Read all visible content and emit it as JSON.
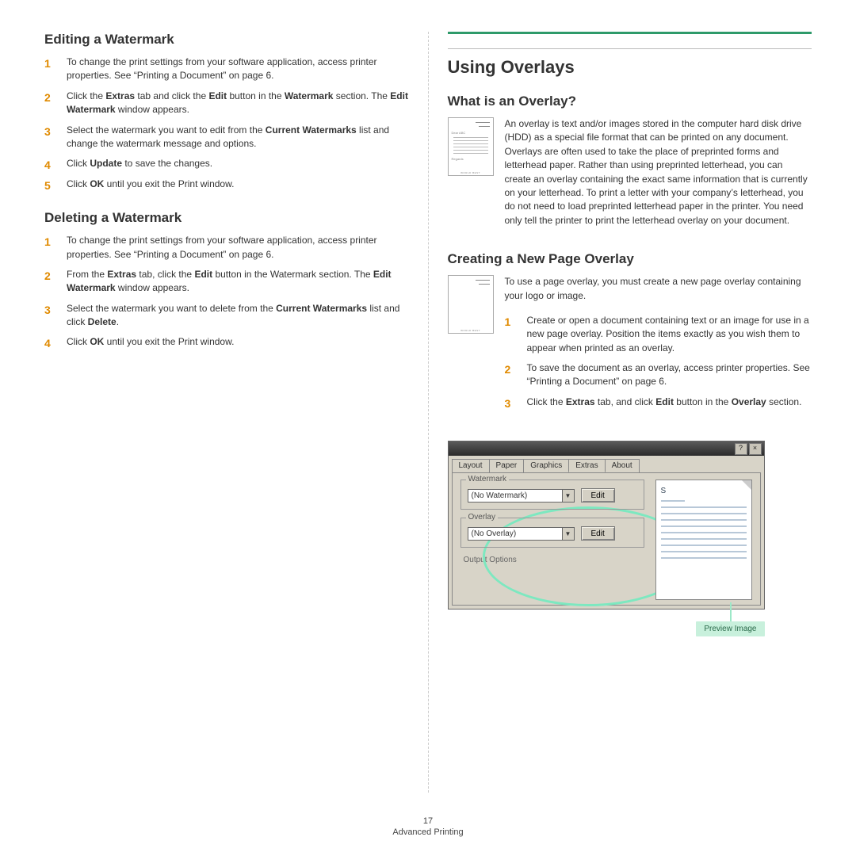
{
  "left": {
    "h2a": "Editing a Watermark",
    "steps_a": [
      "To change the print settings from your software application, access printer properties. See “Printing a Document” on page 6.",
      "Click the <b>Extras</b> tab and click the <b>Edit</b> button in the <b>Watermark</b> section. The <b>Edit Watermark</b> window appears.",
      "Select the watermark you want to edit from the <b>Current Watermarks</b> list and change the watermark message and options.",
      "Click <b>Update</b> to save the changes.",
      "Click <b>OK</b> until you exit the Print window."
    ],
    "h2b": "Deleting a Watermark",
    "steps_b": [
      "To change the print settings from your software application, access printer properties. See “Printing a Document” on page 6.",
      "From the <b>Extras</b> tab, click the <b>Edit</b> button in the Watermark section. The <b>Edit Watermark</b> window appears.",
      "Select the watermark you want to delete from the <b>Current Watermarks</b> list and click <b>Delete</b>.",
      "Click <b>OK</b> until you exit the Print window."
    ]
  },
  "right": {
    "h1": "Using Overlays",
    "h2a": "What is an Overlay?",
    "p_a": "An overlay is text and/or images stored in the computer hard disk drive (HDD) as a special file format that can be printed on any document. Overlays are often used to take the place of preprinted forms and letterhead paper. Rather than using preprinted letterhead, you can create an overlay containing the exact same information that is currently on your letterhead. To print a letter with your company’s letterhead, you do not need to load preprinted letterhead paper in the printer. You need only tell the printer to print the letterhead overlay on your document.",
    "h2b": "Creating a New Page Overlay",
    "p_b": "To use a page overlay, you must create a new page overlay containing your logo or image.",
    "steps_b": [
      "Create or open a document containing text or an image for use in a new page overlay. Position the items exactly as you wish them to appear when printed as an overlay.",
      "To save the document as an overlay, access printer properties. See “Printing a Document” on page 6.",
      "Click the <b>Extras</b> tab, and click <b>Edit</b> button in the <b>Overlay</b> section."
    ],
    "thumb1_text": "Dear ABC",
    "thumb1_foot": "WORLD BEST",
    "thumb2_foot": "WORLD BEST",
    "dialog": {
      "tabs": [
        "Layout",
        "Paper",
        "Graphics",
        "Extras",
        "About"
      ],
      "active_tab": "Extras",
      "group1": "Watermark",
      "combo1": "(No Watermark)",
      "group2": "Overlay",
      "combo2": "(No Overlay)",
      "edit": "Edit",
      "help": "?",
      "close": "×",
      "cut_label": "Output Options",
      "preview_letter": "S"
    },
    "callout": "Preview Image"
  },
  "footer": {
    "page": "17",
    "label": "Advanced Printing"
  }
}
